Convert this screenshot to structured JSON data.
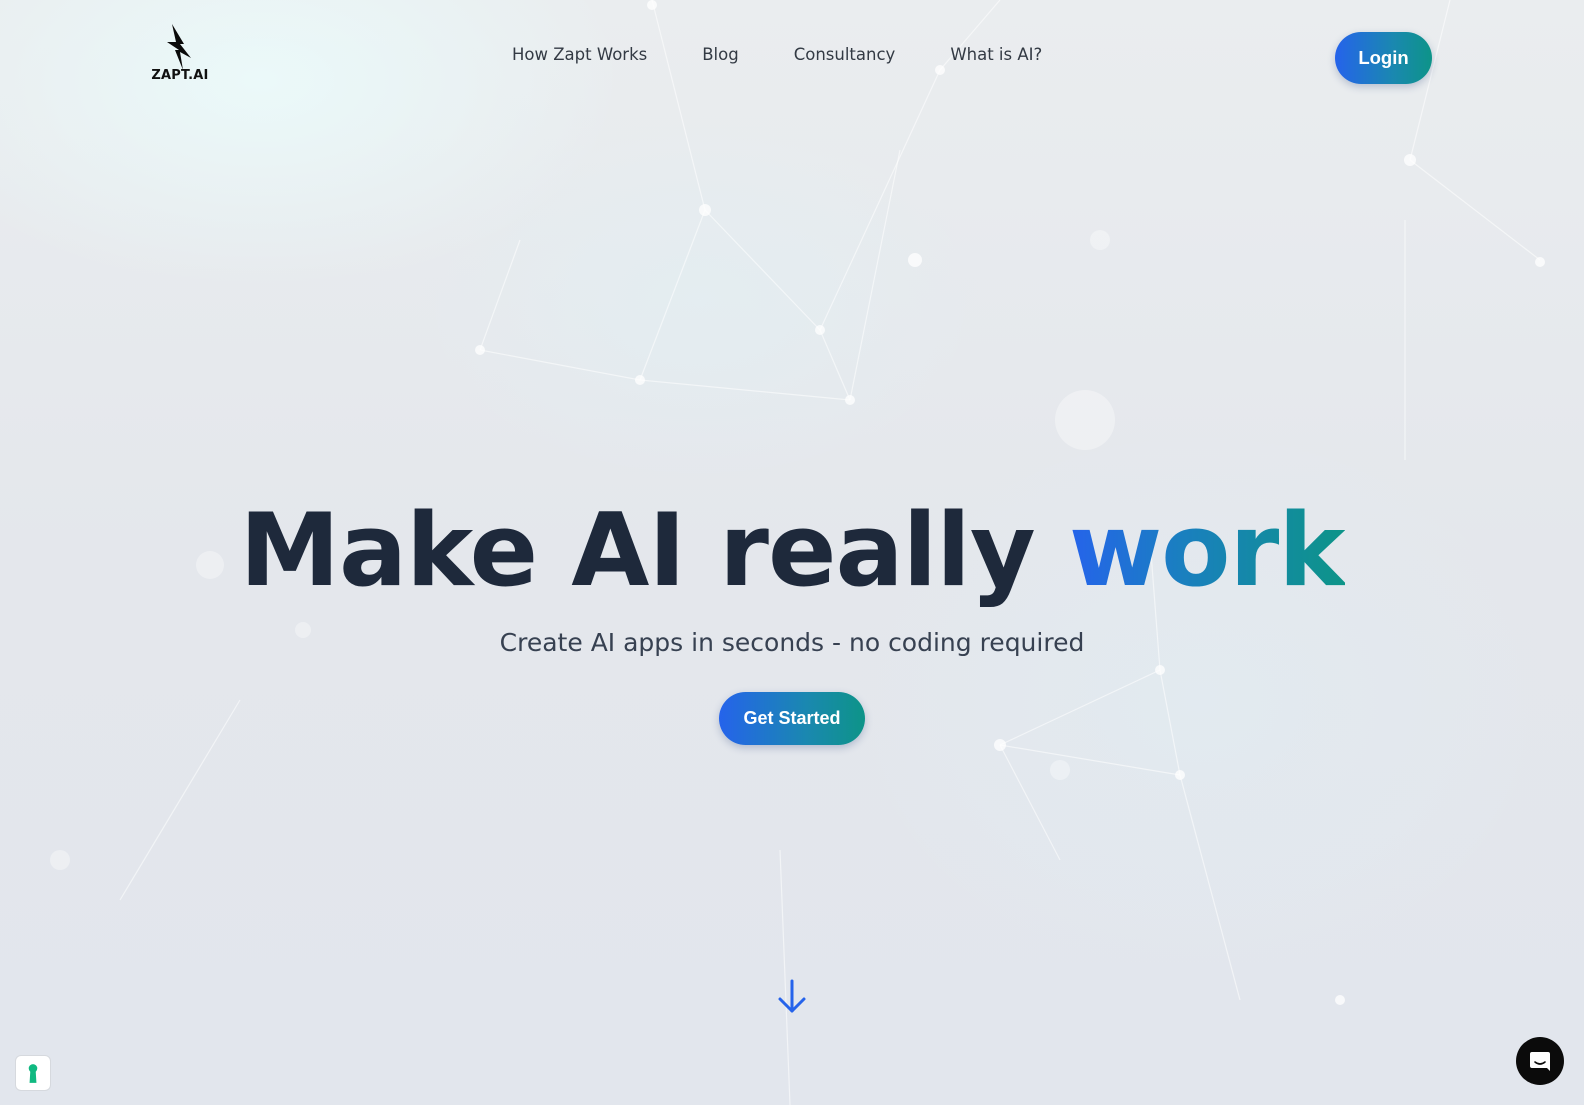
{
  "brand": {
    "name": "ZAPT.AI",
    "logo_icon": "lightning-bolt-icon"
  },
  "nav": {
    "items": [
      {
        "label": "How Zapt Works"
      },
      {
        "label": "Blog"
      },
      {
        "label": "Consultancy"
      },
      {
        "label": "What is AI?"
      }
    ],
    "login_label": "Login"
  },
  "hero": {
    "headline_main": "Make AI really ",
    "headline_accent": "work",
    "subheadline": "Create AI apps in seconds - no coding required",
    "cta_label": "Get Started"
  },
  "widgets": {
    "scroll_icon": "arrow-down-icon",
    "cookie_icon": "keyhole-icon",
    "chat_icon": "chat-bubble-icon"
  },
  "colors": {
    "gradient_start": "#2563eb",
    "gradient_end": "#0d9488",
    "headline": "#1e293b",
    "body_text": "#374151",
    "cookie_accent": "#10b981",
    "chat_bg": "#0b0b0b"
  }
}
